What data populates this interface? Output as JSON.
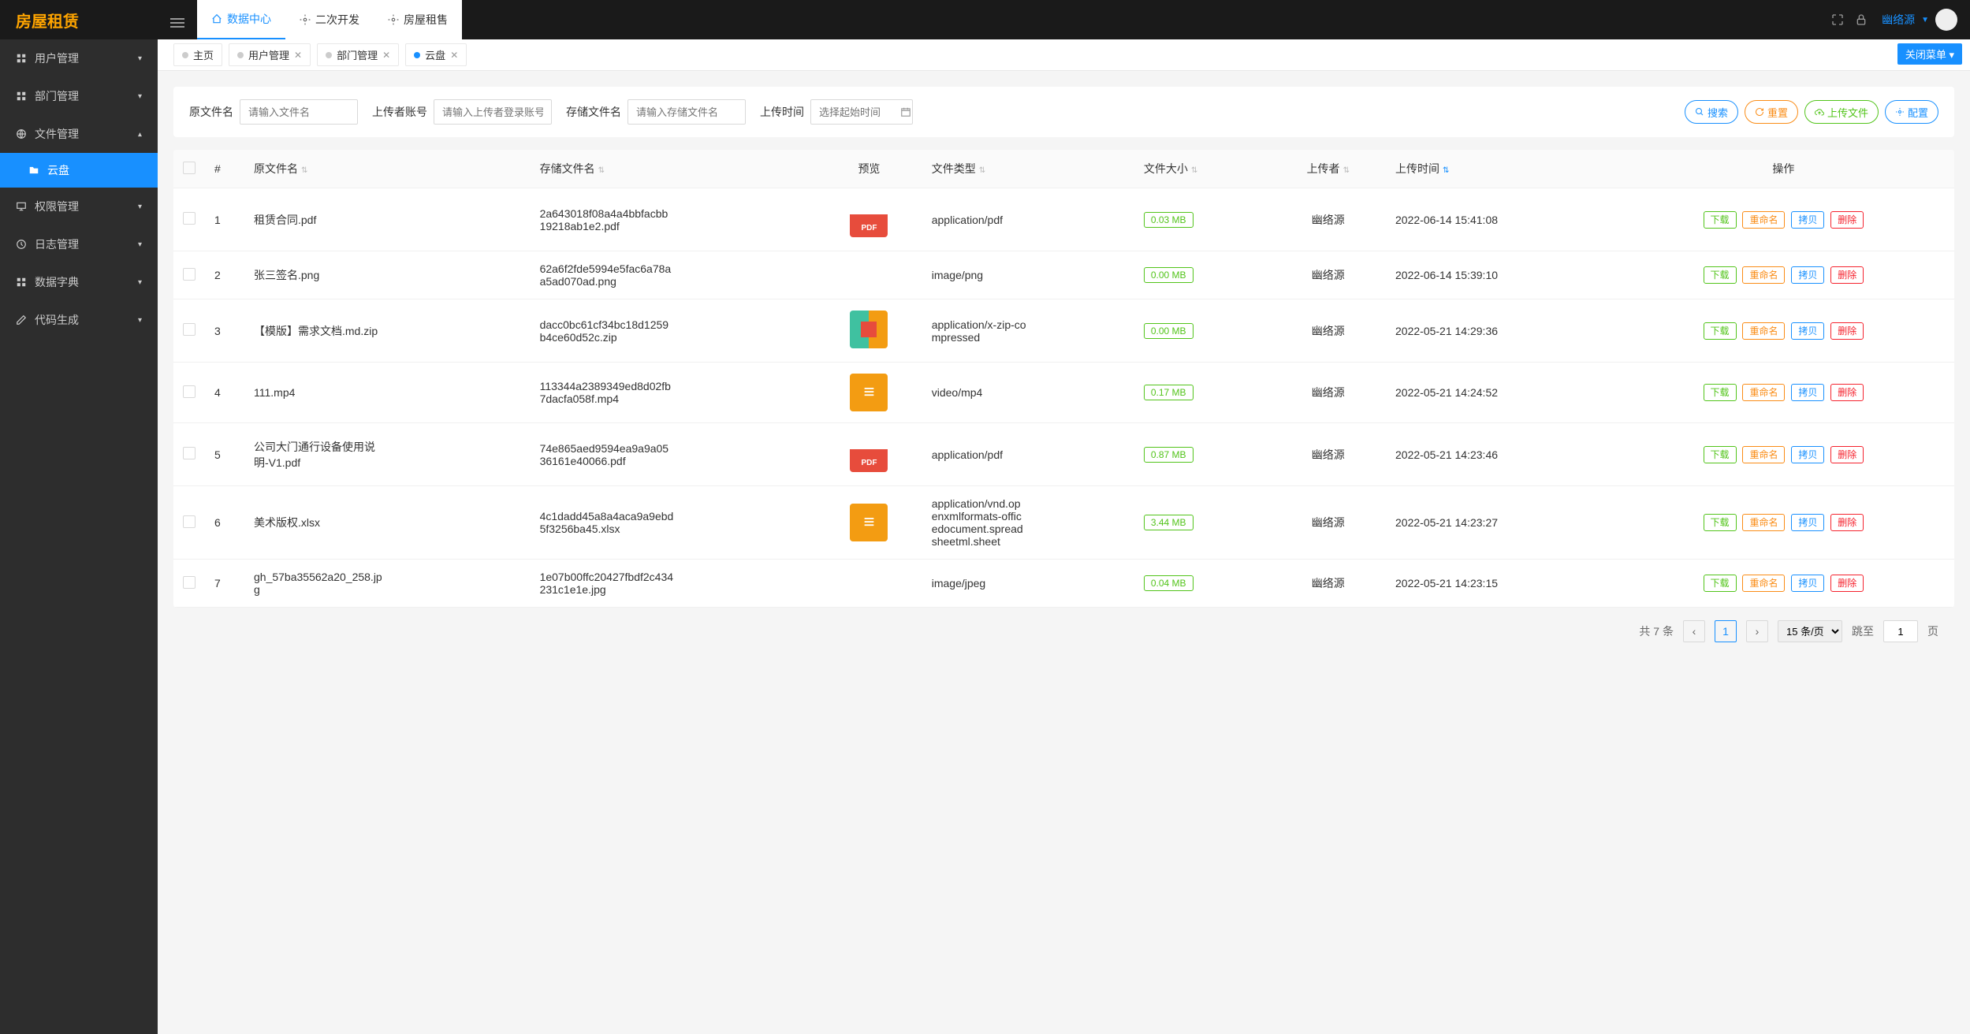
{
  "brand": "房屋租赁",
  "topmenu": [
    {
      "label": "数据中心"
    },
    {
      "label": "二次开发"
    },
    {
      "label": "房屋租售"
    }
  ],
  "user": {
    "name": "幽络源"
  },
  "sidebar": {
    "items": [
      {
        "label": "用户管理"
      },
      {
        "label": "部门管理"
      },
      {
        "label": "文件管理"
      },
      {
        "label": "权限管理"
      },
      {
        "label": "日志管理"
      },
      {
        "label": "数据字典"
      },
      {
        "label": "代码生成"
      }
    ],
    "sub": {
      "label": "云盘"
    }
  },
  "tabs": {
    "items": [
      {
        "label": "主页"
      },
      {
        "label": "用户管理"
      },
      {
        "label": "部门管理"
      },
      {
        "label": "云盘"
      }
    ],
    "closeAll": "关闭菜单"
  },
  "search": {
    "f1": {
      "label": "原文件名",
      "placeholder": "请输入文件名"
    },
    "f2": {
      "label": "上传者账号",
      "placeholder": "请输入上传者登录账号"
    },
    "f3": {
      "label": "存储文件名",
      "placeholder": "请输入存储文件名"
    },
    "f4": {
      "label": "上传时间",
      "placeholder": "选择起始时间"
    },
    "btns": {
      "search": "搜索",
      "reset": "重置",
      "upload": "上传文件",
      "config": "配置"
    }
  },
  "columns": {
    "idx": "#",
    "orig": "原文件名",
    "store": "存储文件名",
    "preview": "预览",
    "type": "文件类型",
    "size": "文件大小",
    "uploader": "上传者",
    "time": "上传时间",
    "ops": "操作"
  },
  "actions": {
    "download": "下载",
    "rename": "重命名",
    "copy": "拷贝",
    "delete": "删除"
  },
  "rows": [
    {
      "idx": "1",
      "orig": "租赁合同.pdf",
      "store": "2a643018f08a4a4bbfacbb19218ab1e2.pdf",
      "icon": "pdf",
      "type": "application/pdf",
      "size": "0.03 MB",
      "uploader": "幽络源",
      "time": "2022-06-14 15:41:08"
    },
    {
      "idx": "2",
      "orig": "张三签名.png",
      "store": "62a6f2fde5994e5fac6a78aa5ad070ad.png",
      "icon": "",
      "type": "image/png",
      "size": "0.00 MB",
      "uploader": "幽络源",
      "time": "2022-06-14 15:39:10"
    },
    {
      "idx": "3",
      "orig": "【模版】需求文档.md.zip",
      "store": "dacc0bc61cf34bc18d1259b4ce60d52c.zip",
      "icon": "zip",
      "type": "application/x-zip-compressed",
      "size": "0.00 MB",
      "uploader": "幽络源",
      "time": "2022-05-21 14:29:36"
    },
    {
      "idx": "4",
      "orig": "111.mp4",
      "store": "113344a2389349ed8d02fb7dacfa058f.mp4",
      "icon": "doc",
      "type": "video/mp4",
      "size": "0.17 MB",
      "uploader": "幽络源",
      "time": "2022-05-21 14:24:52"
    },
    {
      "idx": "5",
      "orig": "公司大门通行设备使用说明-V1.pdf",
      "store": "74e865aed9594ea9a9a0536161e40066.pdf",
      "icon": "pdf",
      "type": "application/pdf",
      "size": "0.87 MB",
      "uploader": "幽络源",
      "time": "2022-05-21 14:23:46"
    },
    {
      "idx": "6",
      "orig": "美术版权.xlsx",
      "store": "4c1dadd45a8a4aca9a9ebd5f3256ba45.xlsx",
      "icon": "doc",
      "type": "application/vnd.openxmlformats-officedocument.spreadsheetml.sheet",
      "size": "3.44 MB",
      "uploader": "幽络源",
      "time": "2022-05-21 14:23:27"
    },
    {
      "idx": "7",
      "orig": "gh_57ba35562a20_258.jpg",
      "store": "1e07b00ffc20427fbdf2c434231c1e1e.jpg",
      "icon": "",
      "type": "image/jpeg",
      "size": "0.04 MB",
      "uploader": "幽络源",
      "time": "2022-05-21 14:23:15"
    }
  ],
  "pager": {
    "total": "共 7 条",
    "current": "1",
    "perPage": "15 条/页",
    "jumpLabel": "跳至",
    "pageSuffix": "页",
    "jumpVal": "1"
  }
}
